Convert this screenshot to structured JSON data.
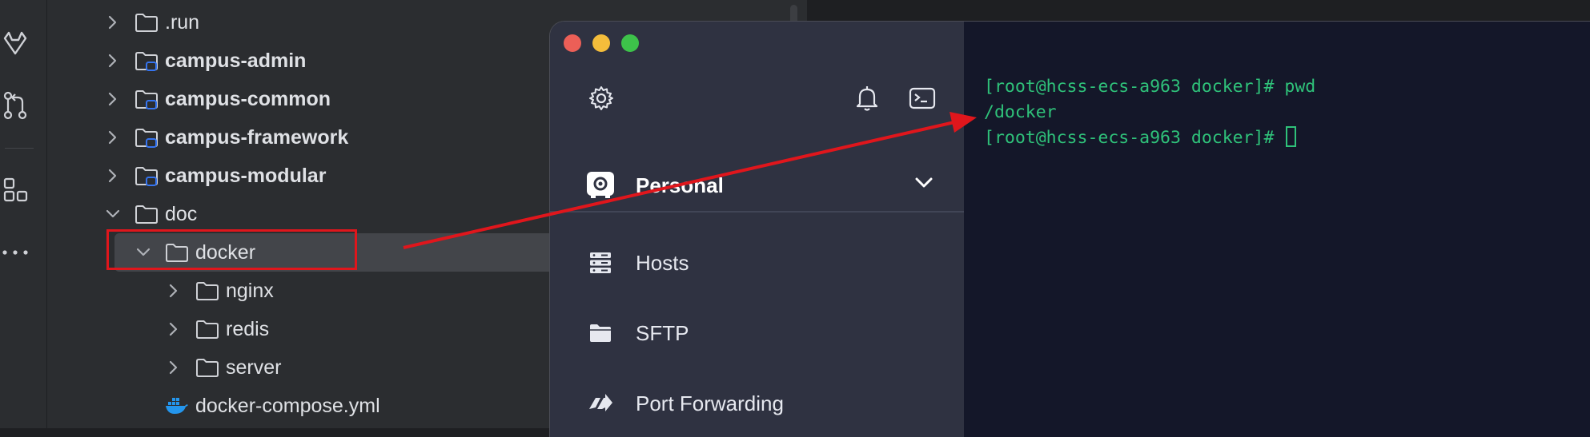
{
  "tree": {
    "items": [
      {
        "label": ".run",
        "bold": false,
        "expanded": false,
        "module": false
      },
      {
        "label": "campus-admin",
        "bold": true,
        "expanded": false,
        "module": true
      },
      {
        "label": "campus-common",
        "bold": true,
        "expanded": false,
        "module": true
      },
      {
        "label": "campus-framework",
        "bold": true,
        "expanded": false,
        "module": true
      },
      {
        "label": "campus-modular",
        "bold": true,
        "expanded": false,
        "module": true
      },
      {
        "label": "doc",
        "bold": false,
        "expanded": true,
        "module": false
      },
      {
        "label": "docker",
        "bold": false,
        "expanded": true,
        "module": false,
        "selected": true
      },
      {
        "label": "nginx",
        "bold": false,
        "expanded": false,
        "module": false
      },
      {
        "label": "redis",
        "bold": false,
        "expanded": false,
        "module": false
      },
      {
        "label": "server",
        "bold": false,
        "expanded": false,
        "module": false
      },
      {
        "label": "docker-compose.yml",
        "bold": false,
        "file": true
      }
    ]
  },
  "app": {
    "vault": "Personal",
    "nav": [
      {
        "label": "Hosts",
        "icon": "hosts-icon"
      },
      {
        "label": "SFTP",
        "icon": "folder-icon"
      },
      {
        "label": "Port Forwarding",
        "icon": "port-forwarding-icon"
      }
    ]
  },
  "terminal": {
    "lines": [
      "[root@hcss-ecs-a963 docker]# pwd",
      "/docker",
      "[root@hcss-ecs-a963 docker]# "
    ]
  },
  "colors": {
    "highlight": "#e0161c",
    "terminal_text": "#2fc27a",
    "module_badge": "#3574f0"
  }
}
